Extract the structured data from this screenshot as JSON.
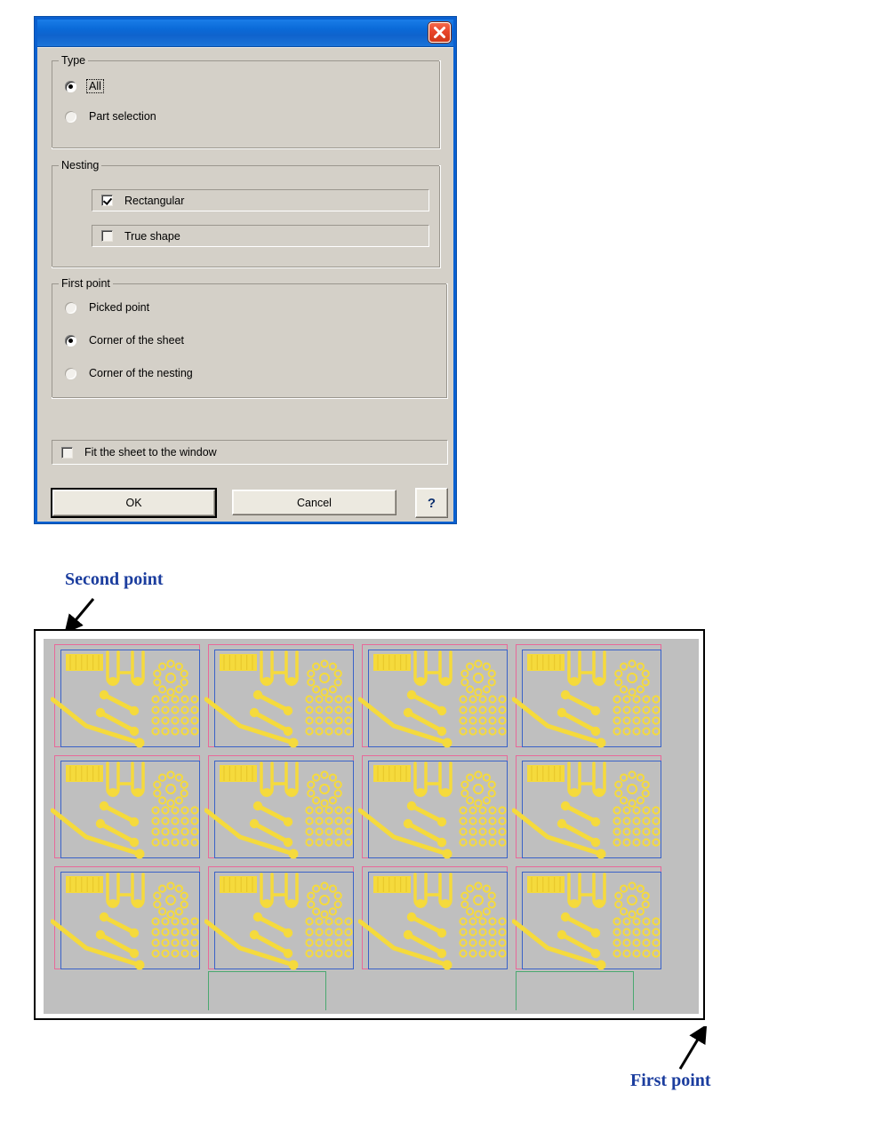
{
  "dialog": {
    "title": "",
    "close_label": "Close",
    "groups": {
      "type": {
        "legend": "Type",
        "options": [
          {
            "label": "All",
            "selected": true,
            "focused": true
          },
          {
            "label": "Part selection",
            "selected": false,
            "focused": false
          }
        ]
      },
      "nesting": {
        "legend": "Nesting",
        "options": [
          {
            "label": "Rectangular",
            "checked": true
          },
          {
            "label": "True shape",
            "checked": false
          }
        ]
      },
      "first_point": {
        "legend": "First point",
        "options": [
          {
            "label": "Picked point",
            "selected": false
          },
          {
            "label": "Corner of the sheet",
            "selected": true
          },
          {
            "label": "Corner of the nesting",
            "selected": false
          }
        ]
      }
    },
    "fit_option": {
      "label": "Fit the sheet to the window",
      "checked": false
    },
    "buttons": {
      "ok": "OK",
      "cancel": "Cancel",
      "help": "?"
    }
  },
  "figure": {
    "annotations": {
      "second_point": "Second point",
      "first_point": "First point"
    },
    "layout": {
      "columns": 4,
      "rows": 3,
      "remnant_rects": 2
    },
    "colors": {
      "part_outline": "#F5DA3C",
      "blue_frame": "#3A62C8",
      "pink_frame": "#E8699A",
      "green_frame": "#4AA870",
      "sheet_fill": "#BFBFBF",
      "annotation": "#1B3D9E"
    }
  }
}
